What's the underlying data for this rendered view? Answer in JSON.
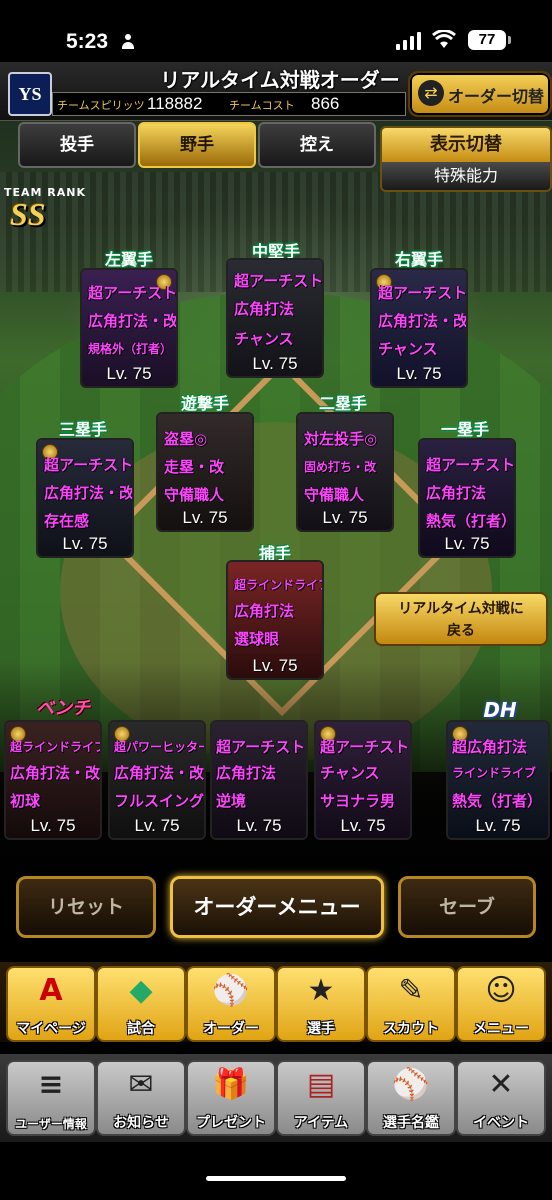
{
  "status_bar": {
    "time": "5:23",
    "battery": "77"
  },
  "header": {
    "title": "リアルタイム対戦オーダー",
    "team_spirits_label": "チームスピリッツ",
    "team_spirits_value": "118882",
    "team_cost_label": "チームコスト",
    "team_cost_value": "866",
    "order_switch_label": "オーダー切替",
    "logo_text": "YS"
  },
  "tabs": [
    {
      "label": "投手",
      "active": false
    },
    {
      "label": "野手",
      "active": true
    },
    {
      "label": "控え",
      "active": false
    }
  ],
  "display_switch": {
    "title": "表示切替",
    "value": "特殊能力"
  },
  "team_rank": {
    "label": "TEAM RANK",
    "value": "SS"
  },
  "fielders": [
    {
      "position": "左翼手",
      "abilities": [
        "超アーチスト",
        "広角打法・改",
        "規格外（打者）"
      ],
      "level": "Lv. 75"
    },
    {
      "position": "中堅手",
      "abilities": [
        "超アーチスト",
        "広角打法",
        "チャンス"
      ],
      "level": "Lv. 75"
    },
    {
      "position": "右翼手",
      "abilities": [
        "超アーチスト",
        "広角打法・改",
        "チャンス"
      ],
      "level": "Lv. 75"
    },
    {
      "position": "遊撃手",
      "abilities": [
        "盗塁◎",
        "走塁・改",
        "守備職人"
      ],
      "level": "Lv. 75"
    },
    {
      "position": "二塁手",
      "abilities": [
        "対左投手◎",
        "固め打ち・改",
        "守備職人"
      ],
      "level": "Lv. 75"
    },
    {
      "position": "三塁手",
      "abilities": [
        "超アーチスト",
        "広角打法・改",
        "存在感"
      ],
      "level": "Lv. 75"
    },
    {
      "position": "一塁手",
      "abilities": [
        "超アーチスト",
        "広角打法",
        "熱気（打者）"
      ],
      "level": "Lv. 75"
    },
    {
      "position": "捕手",
      "abilities": [
        "超ラインドライブ",
        "広角打法",
        "選球眼"
      ],
      "level": "Lv. 75"
    }
  ],
  "bench_label": "ベンチ",
  "dh_label": "DH",
  "bench": [
    {
      "abilities": [
        "超ラインドライブ",
        "広角打法・改",
        "初球"
      ],
      "level": "Lv. 75"
    },
    {
      "abilities": [
        "超パワーヒッター",
        "広角打法・改",
        "フルスイング"
      ],
      "level": "Lv. 75"
    },
    {
      "abilities": [
        "超アーチスト",
        "広角打法",
        "逆境"
      ],
      "level": "Lv. 75"
    },
    {
      "abilities": [
        "超アーチスト",
        "チャンス",
        "サヨナラ男"
      ],
      "level": "Lv. 75"
    }
  ],
  "dh": {
    "abilities": [
      "超広角打法",
      "ラインドライブ",
      "熱気（打者）"
    ],
    "level": "Lv. 75"
  },
  "realtime_button": {
    "line1": "リアルタイム対戦に",
    "line2": "戻る"
  },
  "actions": {
    "reset": "リセット",
    "order_menu": "オーダーメニュー",
    "save": "セーブ"
  },
  "nav_main": [
    {
      "label": "マイページ",
      "icon": "A"
    },
    {
      "label": "試合",
      "icon": "◆"
    },
    {
      "label": "オーダー",
      "icon": "⚾"
    },
    {
      "label": "選手",
      "icon": "★"
    },
    {
      "label": "スカウト",
      "icon": "✎"
    },
    {
      "label": "メニュー",
      "icon": "☺"
    }
  ],
  "nav_sub": [
    {
      "label": "ユーザー情報",
      "icon": "≡"
    },
    {
      "label": "お知らせ",
      "icon": "✉"
    },
    {
      "label": "プレゼント",
      "icon": "🎁"
    },
    {
      "label": "アイテム",
      "icon": "▤"
    },
    {
      "label": "選手名鑑",
      "icon": "⚾"
    },
    {
      "label": "イベント",
      "icon": "✕"
    }
  ]
}
